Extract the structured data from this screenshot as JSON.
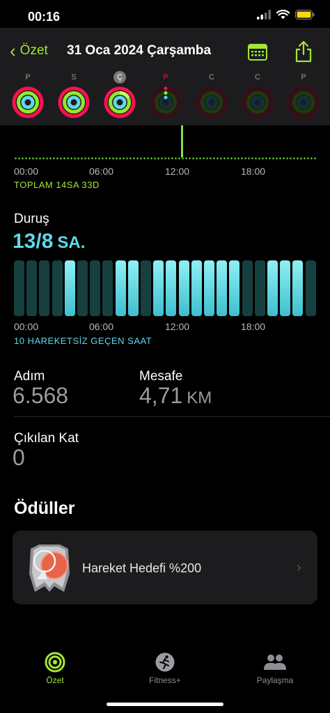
{
  "status_bar": {
    "time": "00:16"
  },
  "header": {
    "back_label": "Özet",
    "title": "31 Oca 2024 Çarşamba"
  },
  "week": [
    {
      "letter": "P",
      "state": "full"
    },
    {
      "letter": "S",
      "state": "full"
    },
    {
      "letter": "Ç",
      "state": "today"
    },
    {
      "letter": "P",
      "state": "dim-active"
    },
    {
      "letter": "C",
      "state": "dim"
    },
    {
      "letter": "C",
      "state": "dim"
    },
    {
      "letter": "P",
      "state": "dim"
    }
  ],
  "timeline": {
    "ticks": [
      "00:00",
      "06:00",
      "12:00",
      "18:00"
    ],
    "total": "TOPLAM 14SA 33D"
  },
  "stand": {
    "label": "Duruş",
    "value": "13/8",
    "unit": "SA.",
    "hours_active": [
      0,
      0,
      0,
      0,
      1,
      0,
      0,
      0,
      1,
      1,
      0,
      1,
      1,
      1,
      1,
      1,
      1,
      1,
      0,
      0,
      1,
      1,
      1,
      0
    ],
    "ticks": [
      "00:00",
      "06:00",
      "12:00",
      "18:00"
    ],
    "inactive_hours": "10 HAREKETSİZ GEÇEN SAAT"
  },
  "steps": {
    "label": "Adım",
    "value": "6.568"
  },
  "distance": {
    "label": "Mesafe",
    "value": "4,71",
    "unit": "KM"
  },
  "floors": {
    "label": "Çıkılan Kat",
    "value": "0"
  },
  "awards": {
    "title": "Ödüller",
    "items": [
      {
        "label": "Hareket Hedefi %200"
      }
    ]
  },
  "tabs": [
    {
      "label": "Özet",
      "active": true
    },
    {
      "label": "Fitness+",
      "active": false
    },
    {
      "label": "Paylaşma",
      "active": false
    }
  ],
  "colors": {
    "accent": "#a3e635",
    "move": "#fa114f",
    "exercise": "#92e82a",
    "stand": "#5fd8e8"
  }
}
